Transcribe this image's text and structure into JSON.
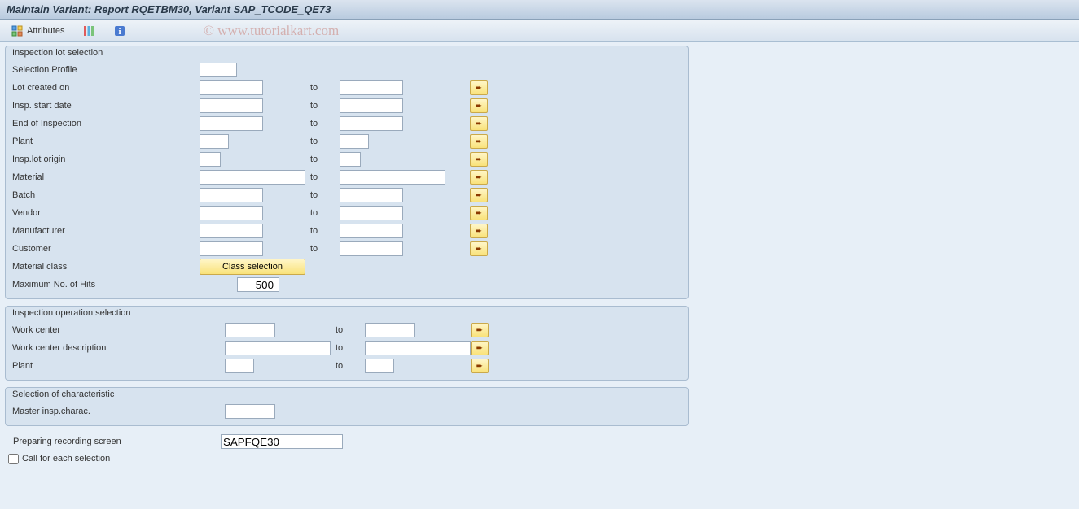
{
  "title": "Maintain Variant: Report RQETBM30, Variant SAP_TCODE_QE73",
  "toolbar": {
    "attributes_label": "Attributes"
  },
  "watermark": "© www.tutorialkart.com",
  "group1": {
    "title": "Inspection lot selection",
    "selection_profile": "Selection Profile",
    "lot_created_on": "Lot created on",
    "insp_start_date": "Insp. start date",
    "end_of_inspection": "End of Inspection",
    "plant": "Plant",
    "insp_lot_origin": "Insp.lot origin",
    "material": "Material",
    "batch": "Batch",
    "vendor": "Vendor",
    "manufacturer": "Manufacturer",
    "customer": "Customer",
    "material_class": "Material class",
    "class_selection_btn": "Class selection",
    "max_hits_label": "Maximum No. of Hits",
    "max_hits_value": "500",
    "to": "to"
  },
  "group2": {
    "title": "Inspection operation selection",
    "work_center": "Work center",
    "work_center_desc": "Work center description",
    "plant": "Plant",
    "to": "to"
  },
  "group3": {
    "title": "Selection of characteristic",
    "master_insp_charac": "Master insp.charac."
  },
  "preparing_label": "Preparing recording screen",
  "preparing_value": "SAPFQE30",
  "call_checkbox": "Call for each selection"
}
